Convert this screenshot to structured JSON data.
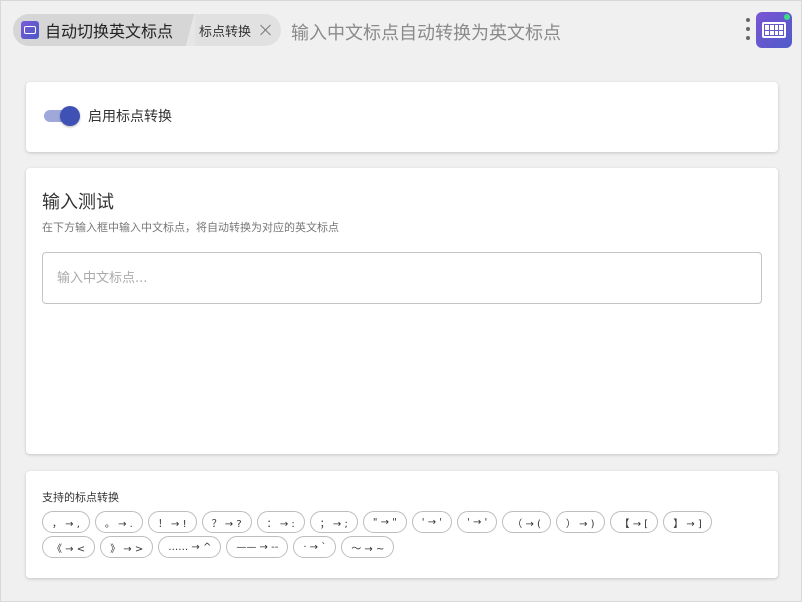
{
  "breadcrumb": {
    "root_label": "自动切换英文标点",
    "child_label": "标点转换"
  },
  "header": {
    "description": "输入中文标点自动转换为英文标点"
  },
  "toggle_card": {
    "label": "启用标点转换",
    "enabled": true
  },
  "test_card": {
    "title": "输入测试",
    "description": "在下方输入框中输入中文标点，将自动转换为对应的英文标点",
    "input_value": "",
    "input_placeholder": "输入中文标点..."
  },
  "support_card": {
    "title": "支持的标点转换",
    "conversions": [
      "， → ,",
      "。 → .",
      "！ → !",
      "？ → ?",
      "： → :",
      "； → ;",
      "\" → \"",
      "' → '",
      "' → '",
      "（ → (",
      "） → )",
      "【 → [",
      "】 → ]",
      "《 → <",
      "》 → >",
      "…… → ^",
      "—— → --",
      "· → `",
      "～ → ~"
    ]
  },
  "colors": {
    "accent": "#3f51b5",
    "accent_light": "#9fa8da",
    "app_icon_start": "#7a55d4",
    "app_icon_end": "#4f5bc9",
    "status_dot": "#3ddc84"
  },
  "icons": {
    "app": "keyboard-icon",
    "close": "close-icon",
    "menu": "more-vertical-icon"
  }
}
